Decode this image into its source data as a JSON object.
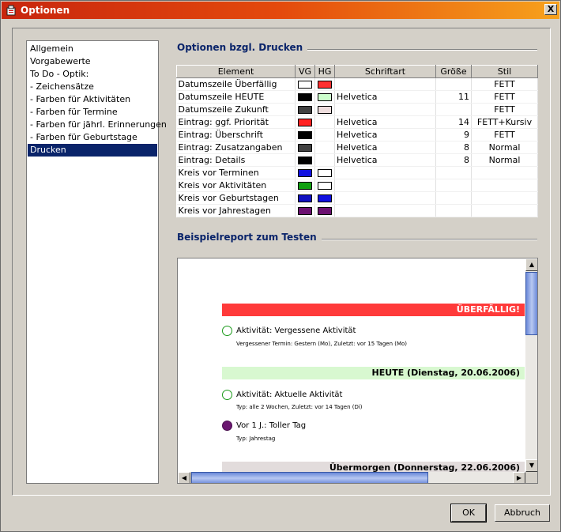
{
  "window": {
    "title": "Optionen",
    "close_label": "X"
  },
  "nav": {
    "items": [
      "Allgemein",
      "Vorgabewerte",
      "To Do - Optik:",
      " - Zeichensätze",
      " - Farben für Aktivitäten",
      " - Farben für Termine",
      " - Farben für jährl. Erinnerungen",
      " - Farben für Geburtstage",
      "Drucken"
    ],
    "selected": "Drucken"
  },
  "print_options": {
    "title": "Optionen bzgl. Drucken",
    "columns": [
      "Element",
      "VG",
      "HG",
      "Schriftart",
      "Größe",
      "Stil"
    ],
    "rows": [
      {
        "element": "Datumszeile Überfällig",
        "vg": "#ffffff",
        "hg": "#ff3030",
        "font": "",
        "size": "",
        "style": "FETT"
      },
      {
        "element": "Datumszeile HEUTE",
        "vg": "#000000",
        "hg": "#ccffcc",
        "font": "Helvetica",
        "size": "11",
        "style": "FETT"
      },
      {
        "element": "Datumszeile Zukunft",
        "vg": "#404040",
        "hg": "#eedddd",
        "font": "",
        "size": "",
        "style": "FETT"
      },
      {
        "element": "Eintrag: ggf. Priorität",
        "vg": "#ff2020",
        "hg": "",
        "font": "Helvetica",
        "size": "14",
        "style": "FETT+Kursiv"
      },
      {
        "element": "Eintrag: Überschrift",
        "vg": "#000000",
        "hg": "",
        "font": "Helvetica",
        "size": "9",
        "style": "FETT"
      },
      {
        "element": "Eintrag: Zusatzangaben",
        "vg": "#404040",
        "hg": "",
        "font": "Helvetica",
        "size": "8",
        "style": "Normal"
      },
      {
        "element": "Eintrag: Details",
        "vg": "#000000",
        "hg": "",
        "font": "Helvetica",
        "size": "8",
        "style": "Normal"
      },
      {
        "element": "Kreis vor Terminen",
        "vg": "#1010e0",
        "hg": "#ffffff",
        "font": "",
        "size": "",
        "style": ""
      },
      {
        "element": "Kreis vor Aktivitäten",
        "vg": "#10a010",
        "hg": "#ffffff",
        "font": "",
        "size": "",
        "style": ""
      },
      {
        "element": "Kreis vor Geburtstagen",
        "vg": "#1010c0",
        "hg": "#1010e0",
        "font": "",
        "size": "",
        "style": ""
      },
      {
        "element": "Kreis vor Jahrestagen",
        "vg": "#6b1070",
        "hg": "#6b1070",
        "font": "",
        "size": "",
        "style": ""
      }
    ]
  },
  "report": {
    "title": "Beispielreport zum Testen",
    "overdue_bar": "ÜBERFÄLLIG!",
    "overdue_entry": "Aktivität: Vergessene Aktivität",
    "overdue_detail": "Vergessener Termin: Gestern (Mo), Zuletzt: vor 15 Tagen (Mo)",
    "today_bar": "HEUTE  (Dienstag, 20.06.2006)",
    "today_entry": "Aktivität: Aktuelle Aktivität",
    "today_detail": "Typ: alle 2 Wochen, Zuletzt: vor 14 Tagen (Di)",
    "anniv_entry": "Vor 1 J.: Toller Tag",
    "anniv_detail": "Typ: Jahrestag",
    "future_bar": "Übermorgen  (Donnerstag, 22.06.2006)"
  },
  "buttons": {
    "ok": "OK",
    "cancel": "Abbruch"
  },
  "colors": {
    "title_start": "#c8260e",
    "title_end": "#f7a21c",
    "selection": "#0a246a",
    "section_title": "#0a246a"
  }
}
